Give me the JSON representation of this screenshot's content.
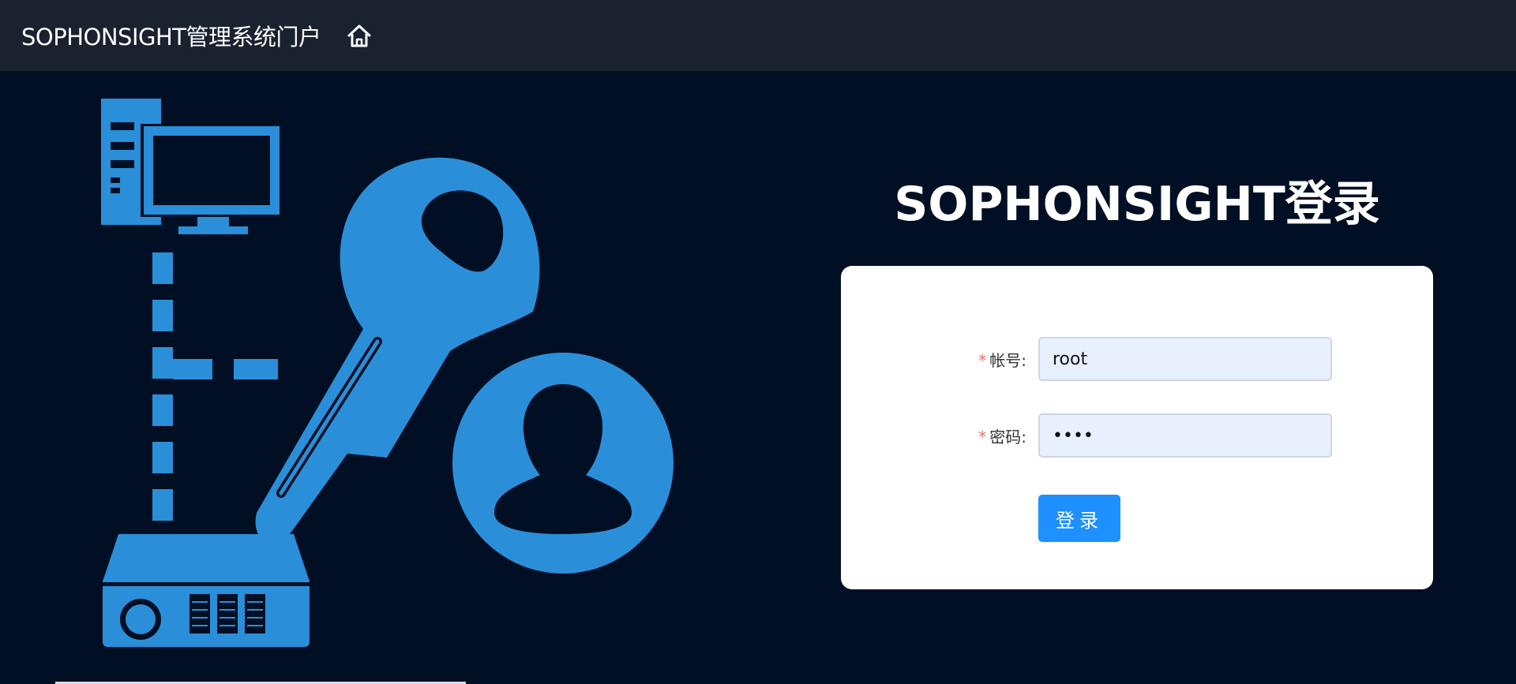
{
  "header": {
    "app_title": "SOPHONSIGHT管理系统门户",
    "home_icon": "home-icon"
  },
  "login": {
    "heading": "SOPHONSIGHT登录",
    "required_mark": "*",
    "account": {
      "label": "帐号:",
      "value": "root",
      "placeholder": ""
    },
    "password": {
      "label": "密码:",
      "value": "••••",
      "placeholder": ""
    },
    "submit_label": "登录"
  },
  "colors": {
    "background": "#000f24",
    "topbar": "#1a2230",
    "illustration_blue": "#2a8fd8",
    "button": "#1e90ff",
    "required": "#f56c6c"
  },
  "illustration": {
    "icons": [
      "computer-icon",
      "key-icon",
      "user-icon",
      "device-icon"
    ]
  }
}
